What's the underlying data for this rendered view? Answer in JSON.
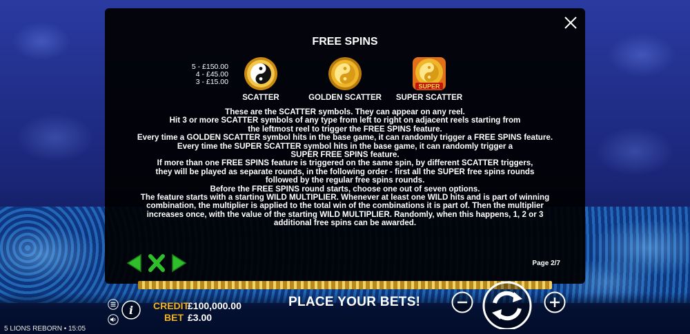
{
  "game": {
    "name": "5 LIONS REBORN",
    "time": "15:05",
    "footer_sep": "•"
  },
  "paytable": {
    "title": "FREE SPINS",
    "pays": [
      "5 - £150.00",
      "4 - £45.00",
      "3 - £15.00"
    ],
    "symbols": [
      {
        "label": "SCATTER",
        "icon": "yin-yang-coin-icon"
      },
      {
        "label": "GOLDEN SCATTER",
        "icon": "golden-yin-yang-coin-icon"
      },
      {
        "label": "SUPER SCATTER",
        "icon": "super-yin-yang-coin-icon",
        "badge": "SUPER"
      }
    ],
    "description": [
      "These are the SCATTER symbols. They can appear on any reel.",
      "Hit 3 or more SCATTER symbols of any type from left to right on adjacent reels starting from",
      "the leftmost reel to trigger the FREE SPINS feature.",
      "Every time a GOLDEN SCATTER symbol hits in the base game, it can randomly trigger a FREE SPINS feature.",
      "Every time the SUPER SCATTER symbol hits in the base game, it can randomly trigger a",
      "SUPER FREE SPINS feature.",
      "If more than one FREE SPINS feature is triggered on the same spin, by different SCATTER triggers,",
      "they will be played as separate rounds, in the following order - first all the SUPER free spins rounds",
      "followed by the regular free spins rounds.",
      "Before the FREE SPINS round starts, choose one out of seven options.",
      "The feature starts with a starting WILD MULTIPLIER. Whenever at least one WILD hits and is part of winning",
      "combination, the multiplier is applied to the total win of the combinations it is part of. Then the multiplier",
      "increases once, with the value of the starting WILD MULTIPLIER. Randomly, when this happens, 1, 2 or 3",
      "additional free spins can be awarded."
    ],
    "page": "Page 2/7"
  },
  "hud": {
    "credit_label": "CREDIT",
    "credit_value": "£100,000.00",
    "bet_label": "BET",
    "bet_value": "£3.00",
    "message": "PLACE YOUR BETS!"
  },
  "colors": {
    "accent": "#f5b318",
    "nav_green": "#2fbf2a",
    "modal_bg": "#000000"
  }
}
